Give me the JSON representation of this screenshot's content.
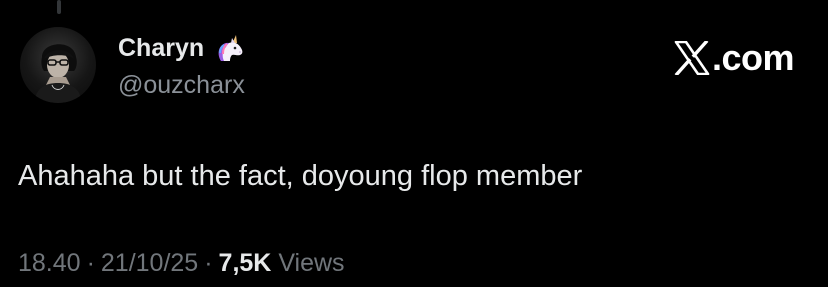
{
  "author": {
    "display_name": "Charyn",
    "handle": "@ouzcharx",
    "name_emoji_icon": "unicorn-icon"
  },
  "brand": {
    "logo_icon": "x-logo-icon",
    "suffix": ".com"
  },
  "tweet": {
    "text": "Ahahaha but the fact, doyoung flop member"
  },
  "meta": {
    "time": "18.40",
    "separator": "·",
    "date": "21/10/25",
    "views_count": "7,5K",
    "views_label": "Views"
  },
  "colors": {
    "background": "#000000",
    "primary_text": "#e7e9ea",
    "secondary_text": "#71767b",
    "unicorn_mane": "#9b5de5"
  }
}
